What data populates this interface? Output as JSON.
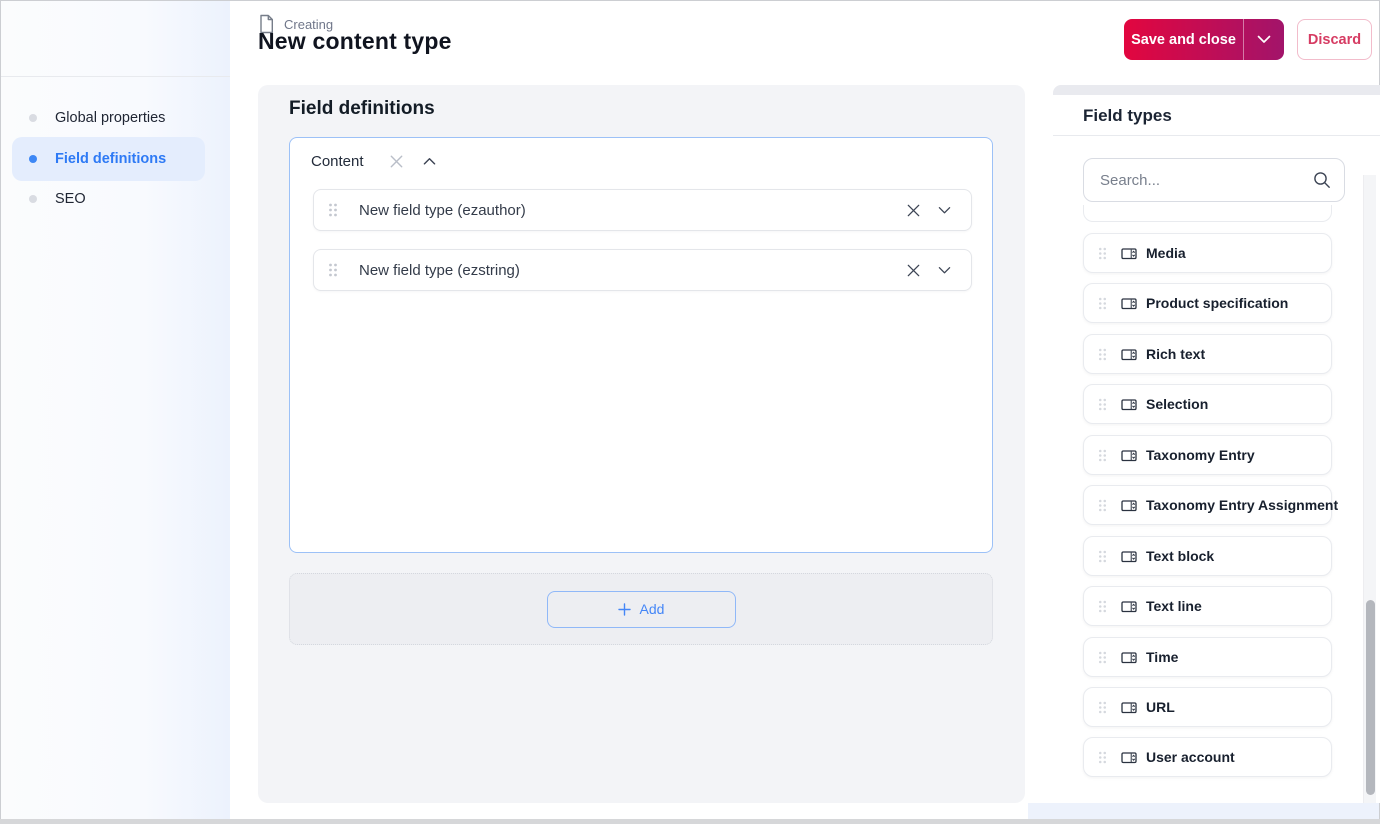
{
  "header": {
    "status_label": "Creating",
    "title": "New content type",
    "save_button": "Save and close",
    "discard_button": "Discard"
  },
  "sidebar": {
    "items": [
      {
        "label": "Global properties",
        "active": false
      },
      {
        "label": "Field definitions",
        "active": true
      },
      {
        "label": "SEO",
        "active": false
      }
    ]
  },
  "main": {
    "section_title": "Field definitions",
    "group_name": "Content",
    "fields": [
      {
        "label": "New field type (ezauthor)"
      },
      {
        "label": "New field type (ezstring)"
      }
    ],
    "add_button": "Add"
  },
  "field_types_panel": {
    "title": "Field types",
    "search_placeholder": "Search...",
    "items": [
      "Media",
      "Product specification",
      "Rich text",
      "Selection",
      "Taxonomy Entry",
      "Taxonomy Entry Assignment",
      "Text block",
      "Text line",
      "Time",
      "URL",
      "User account"
    ]
  },
  "colors": {
    "primary_gradient_start": "#e2063f",
    "primary_gradient_end": "#a2146a",
    "discard_red": "#d63c63",
    "accent_blue": "#4486f7",
    "active_nav_blue": "#2e7af5",
    "group_border_blue": "#9cc1f7",
    "panel_gray": "#f3f4f7"
  }
}
